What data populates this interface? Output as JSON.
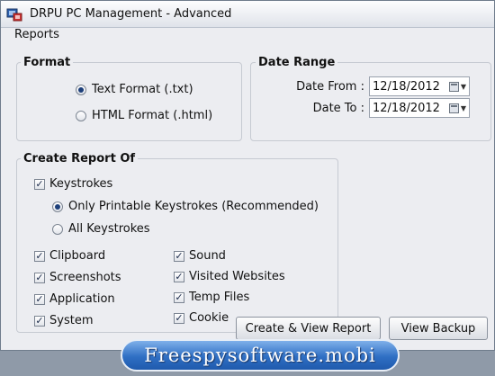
{
  "window": {
    "title": "DRPU PC Management - Advanced",
    "section_label": "Reports"
  },
  "format": {
    "title": "Format",
    "options": [
      {
        "label": "Text Format (.txt)",
        "selected": true
      },
      {
        "label": "HTML Format (.html)",
        "selected": false
      }
    ]
  },
  "date_range": {
    "title": "Date Range",
    "from_label": "Date From :",
    "from_value": "12/18/2012",
    "to_label": "Date To :",
    "to_value": "12/18/2012"
  },
  "create_report": {
    "title": "Create Report Of",
    "keystrokes": {
      "label": "Keystrokes",
      "checked": true
    },
    "keystroke_options": [
      {
        "label": "Only Printable Keystrokes (Recommended)",
        "selected": true
      },
      {
        "label": "All Keystrokes",
        "selected": false
      }
    ],
    "left_items": [
      {
        "label": "Clipboard",
        "checked": true
      },
      {
        "label": "Screenshots",
        "checked": true
      },
      {
        "label": "Application",
        "checked": true
      },
      {
        "label": "System",
        "checked": true
      }
    ],
    "right_items": [
      {
        "label": "Sound",
        "checked": true
      },
      {
        "label": "Visited Websites",
        "checked": true
      },
      {
        "label": "Temp Files",
        "checked": true
      },
      {
        "label": "Cookie",
        "checked": true
      }
    ]
  },
  "buttons": {
    "create_view": "Create & View Report",
    "view_backup": "View Backup"
  },
  "banner": {
    "text": "Freespysoftware.mobi"
  },
  "icons": {
    "app": "app-logo-icon",
    "calendar": "calendar-icon",
    "dropdown": "dropdown-arrow-icon",
    "check_mark": "✓"
  }
}
